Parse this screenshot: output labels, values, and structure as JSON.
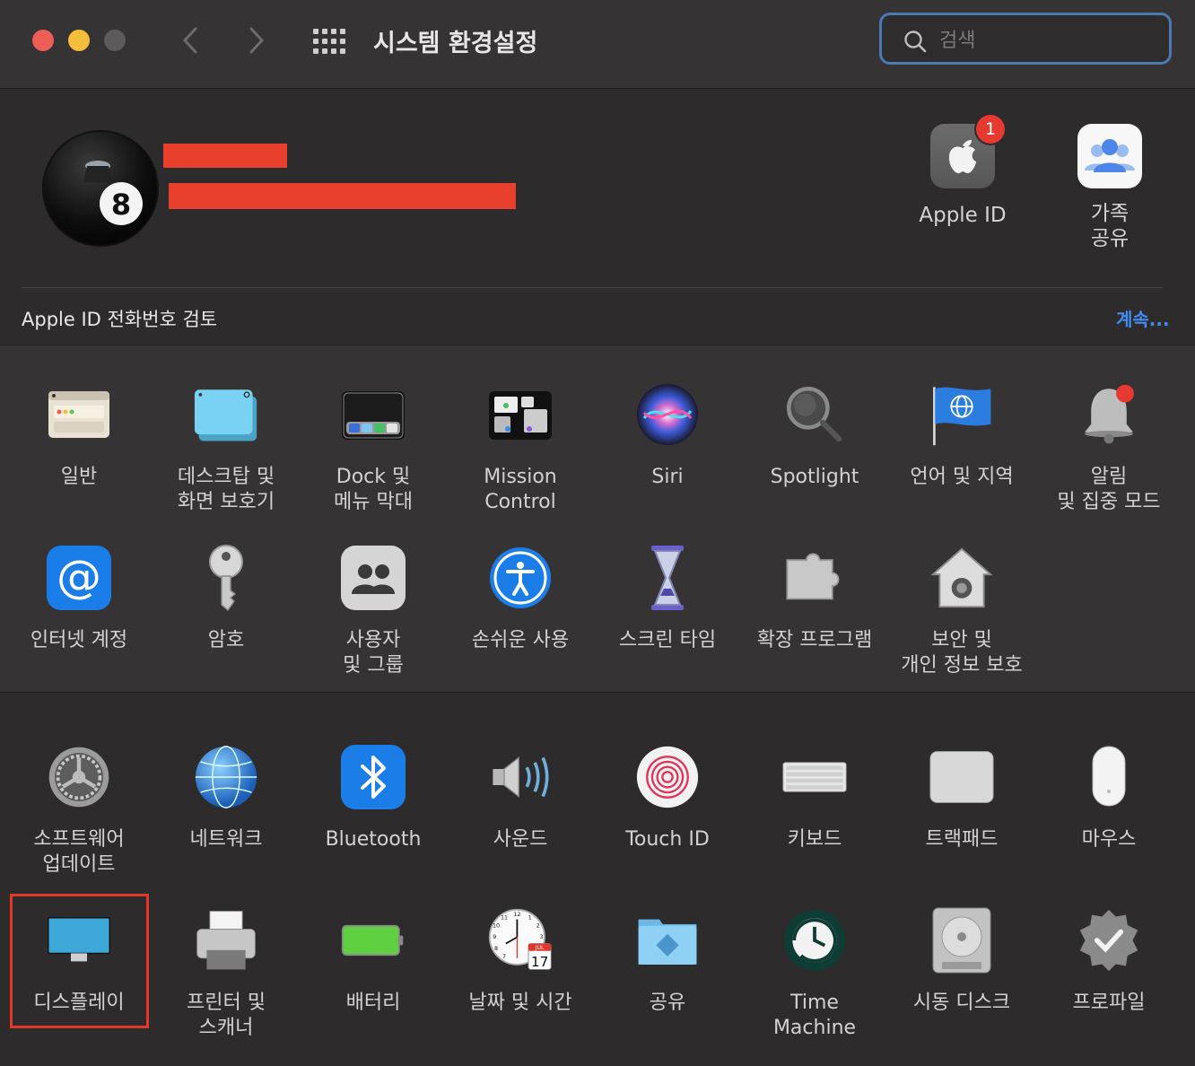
{
  "window": {
    "title": "시스템 환경설정",
    "search_placeholder": "검색",
    "colors": {
      "close": "#ee5d55",
      "minimize": "#f5bd3c",
      "accent": "#4a79b4"
    }
  },
  "account": {
    "apple_id_label": "Apple ID",
    "apple_id_badge": "1",
    "family_label_line1": "가족",
    "family_label_line2": "공유"
  },
  "notice": {
    "text": "Apple ID 전화번호 검토",
    "link": "계속..."
  },
  "rows": [
    [
      {
        "icon": "general-icon",
        "l1": "일반",
        "l2": ""
      },
      {
        "icon": "desktop-screensaver-icon",
        "l1": "데스크탑 및",
        "l2": "화면 보호기"
      },
      {
        "icon": "dock-icon",
        "l1": "Dock 및",
        "l2": "메뉴 막대"
      },
      {
        "icon": "mission-control-icon",
        "l1": "Mission",
        "l2": "Control"
      },
      {
        "icon": "siri-icon",
        "l1": "Siri",
        "l2": ""
      },
      {
        "icon": "spotlight-icon",
        "l1": "Spotlight",
        "l2": ""
      },
      {
        "icon": "language-region-icon",
        "l1": "언어 및 지역",
        "l2": ""
      },
      {
        "icon": "notifications-icon",
        "l1": "알림",
        "l2": "및 집중 모드"
      }
    ],
    [
      {
        "icon": "internet-accounts-icon",
        "l1": "인터넷 계정",
        "l2": ""
      },
      {
        "icon": "passwords-icon",
        "l1": "암호",
        "l2": ""
      },
      {
        "icon": "users-groups-icon",
        "l1": "사용자",
        "l2": "및 그룹"
      },
      {
        "icon": "accessibility-icon",
        "l1": "손쉬운 사용",
        "l2": ""
      },
      {
        "icon": "screen-time-icon",
        "l1": "스크린 타임",
        "l2": ""
      },
      {
        "icon": "extensions-icon",
        "l1": "확장 프로그램",
        "l2": ""
      },
      {
        "icon": "security-privacy-icon",
        "l1": "보안 및",
        "l2": "개인 정보 보호"
      }
    ],
    [
      {
        "icon": "software-update-icon",
        "l1": "소프트웨어",
        "l2": "업데이트"
      },
      {
        "icon": "network-icon",
        "l1": "네트워크",
        "l2": ""
      },
      {
        "icon": "bluetooth-icon",
        "l1": "Bluetooth",
        "l2": ""
      },
      {
        "icon": "sound-icon",
        "l1": "사운드",
        "l2": ""
      },
      {
        "icon": "touch-id-icon",
        "l1": "Touch ID",
        "l2": ""
      },
      {
        "icon": "keyboard-icon",
        "l1": "키보드",
        "l2": ""
      },
      {
        "icon": "trackpad-icon",
        "l1": "트랙패드",
        "l2": ""
      },
      {
        "icon": "mouse-icon",
        "l1": "마우스",
        "l2": ""
      }
    ],
    [
      {
        "icon": "displays-icon",
        "l1": "디스플레이",
        "l2": ""
      },
      {
        "icon": "printers-scanners-icon",
        "l1": "프린터 및",
        "l2": "스캐너"
      },
      {
        "icon": "battery-icon",
        "l1": "배터리",
        "l2": ""
      },
      {
        "icon": "date-time-icon",
        "l1": "날짜 및 시간",
        "l2": ""
      },
      {
        "icon": "sharing-icon",
        "l1": "공유",
        "l2": ""
      },
      {
        "icon": "time-machine-icon",
        "l1": "Time",
        "l2": "Machine"
      },
      {
        "icon": "startup-disk-icon",
        "l1": "시동 디스크",
        "l2": ""
      },
      {
        "icon": "profiles-icon",
        "l1": "프로파일",
        "l2": ""
      }
    ]
  ],
  "calendar": {
    "month": "JUL",
    "day": "17"
  },
  "eight_ball": "8"
}
